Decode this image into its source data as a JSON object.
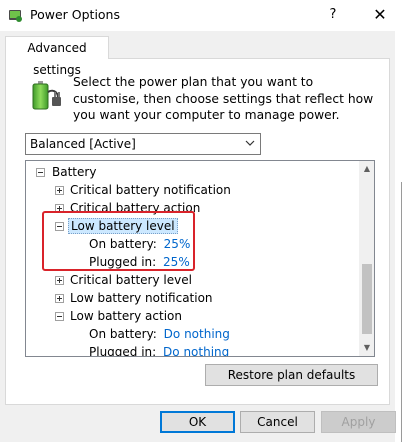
{
  "window": {
    "title": "Power Options",
    "help_glyph": "?",
    "close_glyph": "✕"
  },
  "tab": {
    "label": "Advanced settings"
  },
  "description": "Select the power plan that you want to customise, then choose settings that reflect how you want your computer to manage power.",
  "plan_select": {
    "value": "Balanced [Active]"
  },
  "tree": {
    "rows": [
      {
        "id": "battery",
        "label": "Battery"
      },
      {
        "id": "critical-battery-notification",
        "label": "Critical battery notification"
      },
      {
        "id": "critical-battery-action",
        "label": "Critical battery action"
      },
      {
        "id": "low-battery-level",
        "label": "Low battery level"
      },
      {
        "id": "low-battery-level-on-battery",
        "label": "On battery:",
        "value": "25%"
      },
      {
        "id": "low-battery-level-plugged-in",
        "label": "Plugged in:",
        "value": "25%"
      },
      {
        "id": "critical-battery-level",
        "label": "Critical battery level"
      },
      {
        "id": "low-battery-notification",
        "label": "Low battery notification"
      },
      {
        "id": "low-battery-action",
        "label": "Low battery action"
      },
      {
        "id": "low-battery-action-on-battery",
        "label": "On battery:",
        "value": "Do nothing"
      },
      {
        "id": "low-battery-action-plugged-in",
        "label": "Plugged in:",
        "value": "Do nothing"
      }
    ]
  },
  "buttons": {
    "restore": "Restore plan defaults",
    "ok": "OK",
    "cancel": "Cancel",
    "apply": "Apply"
  },
  "colors": {
    "link": "#0066cc",
    "selection": "#cce8ff",
    "annotation": "#d9232a"
  }
}
